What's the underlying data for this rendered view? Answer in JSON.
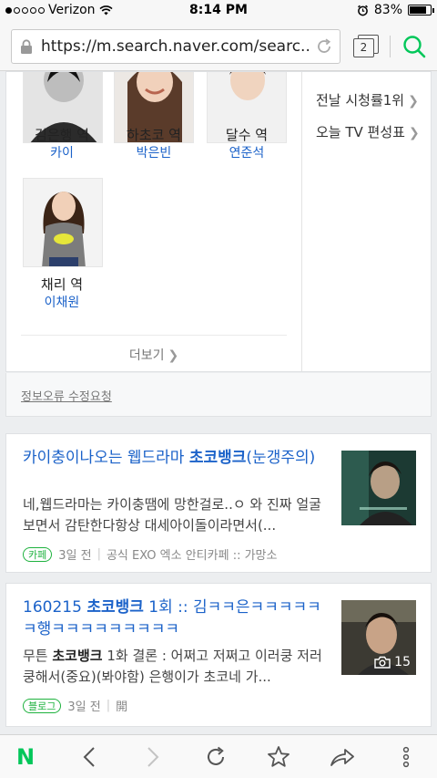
{
  "status_bar": {
    "carrier": "Verizon",
    "time": "8:14 PM",
    "battery": "83%",
    "battery_level": 0.83
  },
  "url_bar": {
    "url": "https://m.search.naver.com/searc...",
    "tab_count": "2"
  },
  "cast": {
    "members": [
      {
        "role": "김은행 역",
        "actor": "카이"
      },
      {
        "role": "하초코 역",
        "actor": "박은빈"
      },
      {
        "role": "달수 역",
        "actor": "연준석"
      },
      {
        "role": "채리 역",
        "actor": "이채원"
      }
    ],
    "side_links": [
      "전날 시청률1위",
      "오늘 TV 편성표"
    ],
    "more_label": "더보기"
  },
  "report_link": "정보오류 수정요청",
  "results": [
    {
      "title_pre": "카이충이나오는 웹드라마 ",
      "title_bold": "초코뱅크",
      "title_post": "(눈갱주의)",
      "desc_pre": "네,웹드라마는 카이충땜에 망한걸로..ㅇ 와 진짜 얼굴보면서 감탄한다항상 대세아이돌이라면서(...",
      "desc_bold": "",
      "desc_post": "",
      "badge": "카페",
      "date": "3일 전",
      "source": "공식 EXO 엑소 안티카페 :: 가망소",
      "photo_count": ""
    },
    {
      "title_pre": "160215 ",
      "title_bold": "초코뱅크",
      "title_post": " 1회 :: 김ㅋㅋ은ㅋㅋㅋㅋㅋㅋ행ㅋㅋㅋㅋㅋㅋㅋㅋㅋ",
      "desc_pre": "무튼 ",
      "desc_bold": "초코뱅크",
      "desc_post": " 1화 결론 : 어쩌고 저쩌고 이러쿵 저러쿵해서(중요)(봐야함) 은행이가 초코네 가...",
      "badge": "블로그",
      "date": "3일 전",
      "source": "開",
      "photo_count": "15"
    }
  ],
  "colors": {
    "naver_green": "#03c75a",
    "link_blue": "#1b62c9"
  },
  "toolbar": {
    "icons": [
      "naver-home-icon",
      "back-icon",
      "forward-icon",
      "reload-icon",
      "bookmark-star-icon",
      "share-icon",
      "more-icon"
    ],
    "logo_text": "N"
  }
}
